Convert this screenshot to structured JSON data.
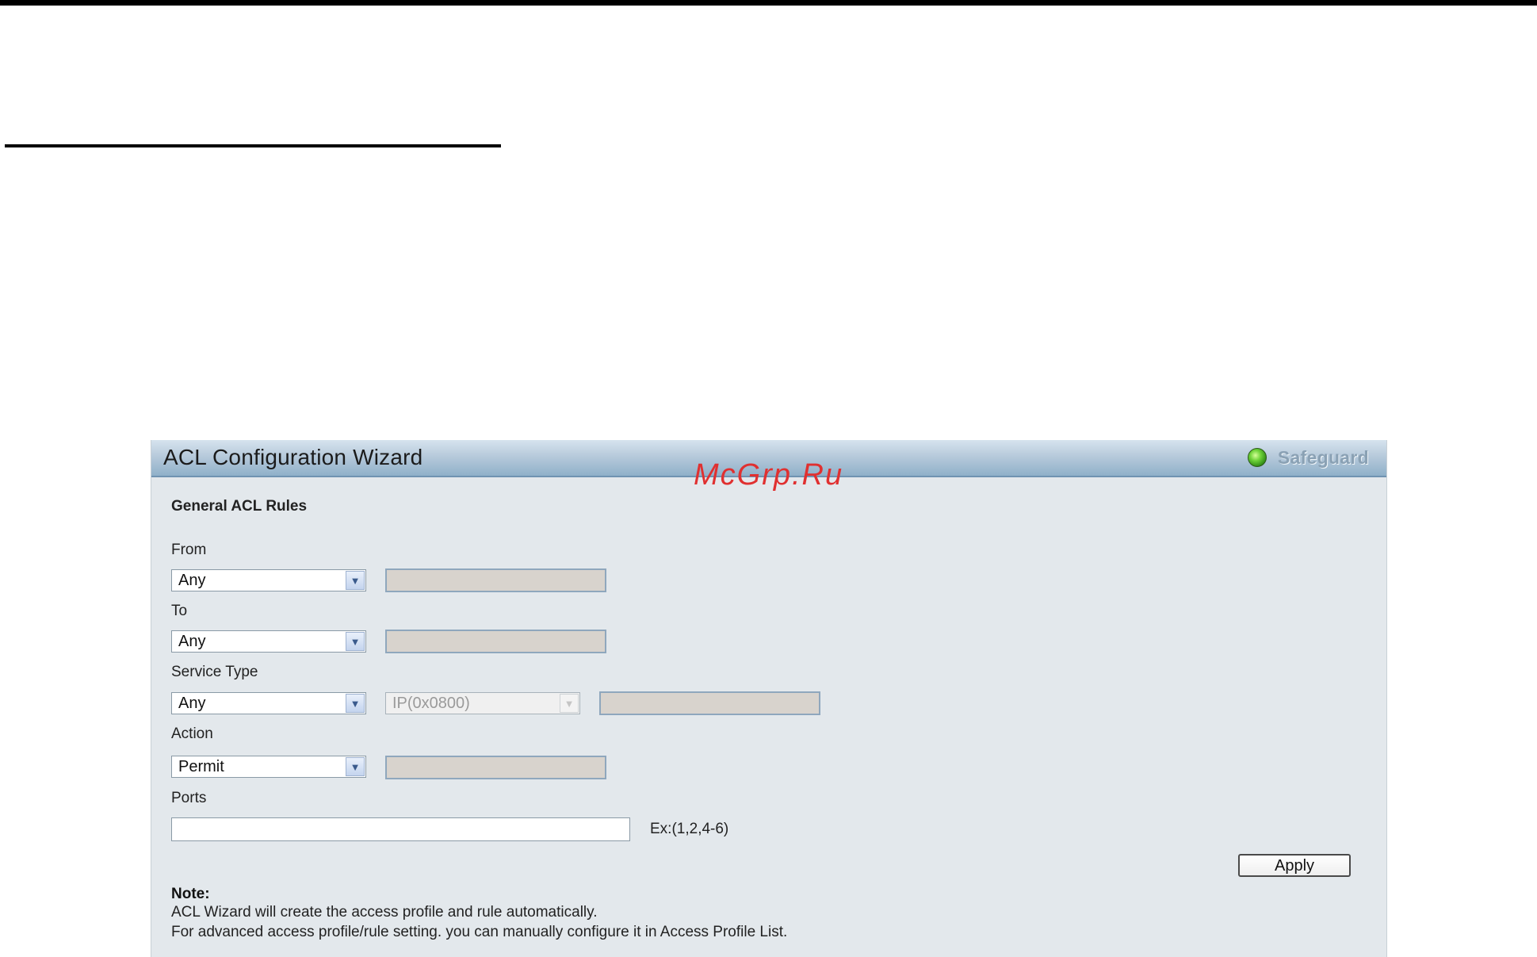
{
  "watermark": "McGrp.Ru",
  "window": {
    "title": "ACL Configuration Wizard",
    "safeguard_label": "Safeguard"
  },
  "form": {
    "section_title": "General ACL Rules",
    "from": {
      "label": "From",
      "selected": "Any"
    },
    "to": {
      "label": "To",
      "selected": "Any"
    },
    "service_type": {
      "label": "Service Type",
      "selected": "Any",
      "protocol_selected": "IP(0x0800)"
    },
    "action": {
      "label": "Action",
      "selected": "Permit"
    },
    "ports": {
      "label": "Ports",
      "value": "",
      "hint": "Ex:(1,2,4-6)"
    },
    "apply_label": "Apply"
  },
  "note": {
    "title": "Note:",
    "line1": "ACL Wizard will create the access profile and rule automatically.",
    "line2": "For advanced access profile/rule setting. you can manually configure it in Access Profile List."
  },
  "colors": {
    "panel_bg": "#e3e8ec",
    "titlebar_blue": "#8fb0c9",
    "disabled_field": "#d8d3cd",
    "watermark": "#e03030",
    "led_green": "#6fd33a"
  }
}
